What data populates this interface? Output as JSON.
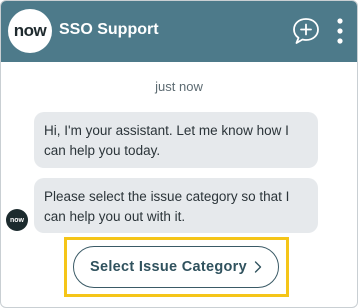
{
  "header": {
    "logo_text": "now",
    "title": "SSO Support",
    "new_chat_icon": "chat-plus-icon",
    "menu_icon": "more-vertical-icon"
  },
  "conversation": {
    "timestamp": "just now",
    "messages": [
      {
        "sender": "bot",
        "text": "Hi, I'm your assistant. Let me know how I can help you today."
      },
      {
        "sender": "bot",
        "text": "Please select the issue category so that I can help you out with it."
      }
    ],
    "bot_avatar_text": "now"
  },
  "action": {
    "label": "Select Issue Category",
    "icon": "chevron-right-icon"
  },
  "colors": {
    "header_bg": "#4d7a8a",
    "bubble_bg": "#e6e9ec",
    "highlight": "#f5c518",
    "button_border": "#3a5a66"
  }
}
